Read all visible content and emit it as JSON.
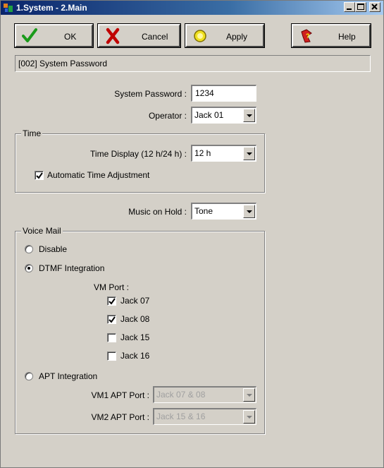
{
  "window": {
    "title": "1.System - 2.Main"
  },
  "toolbar": {
    "ok": "OK",
    "cancel": "Cancel",
    "apply": "Apply",
    "help": "Help"
  },
  "header": {
    "text": "[002] System Password"
  },
  "password": {
    "label": "System Password :",
    "value": "1234"
  },
  "operator": {
    "label": "Operator :",
    "value": "Jack 01"
  },
  "time": {
    "group_title": "Time",
    "display_label": "Time Display (12 h/24 h) :",
    "display_value": "12 h",
    "auto_adjust_label": "Automatic Time Adjustment",
    "auto_adjust_checked": true
  },
  "music": {
    "label": "Music on Hold :",
    "value": "Tone"
  },
  "voicemail": {
    "group_title": "Voice Mail",
    "disable_label": "Disable",
    "dtmf_label": "DTMF Integration",
    "vm_port_label": "VM Port :",
    "ports": [
      {
        "label": "Jack 07",
        "checked": true
      },
      {
        "label": "Jack 08",
        "checked": true
      },
      {
        "label": "Jack 15",
        "checked": false
      },
      {
        "label": "Jack 16",
        "checked": false
      }
    ],
    "apt_label": "APT Integration",
    "vm1_label": "VM1 APT Port :",
    "vm1_value": "Jack 07 & 08",
    "vm2_label": "VM2 APT Port :",
    "vm2_value": "Jack 15 & 16",
    "selected_mode": "DTMF Integration"
  }
}
